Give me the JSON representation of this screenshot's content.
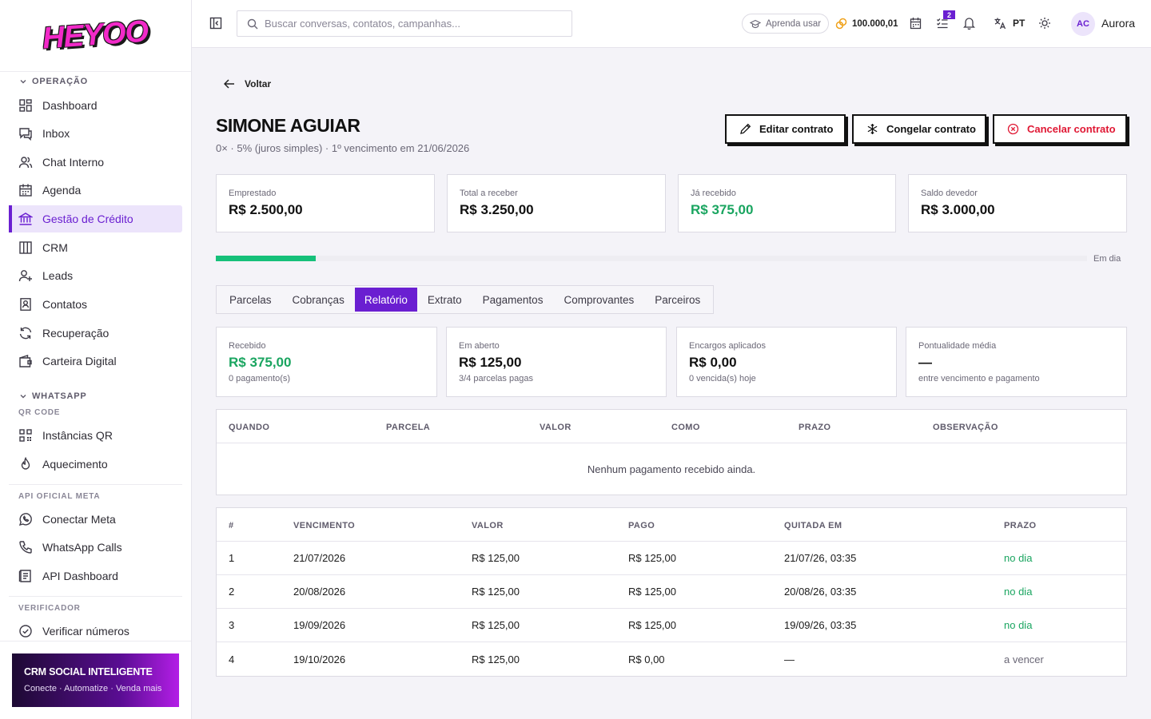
{
  "brand": {
    "logo_text": "HEYOO"
  },
  "sidebar": {
    "sections": {
      "operacao": "OPERAÇÃO",
      "whatsapp": "WHATSAPP",
      "qr_code": "QR CODE",
      "api_oficial": "API OFICIAL META",
      "verificador": "VERIFICADOR"
    },
    "items": [
      {
        "label": "Dashboard",
        "icon": "dashboard-icon"
      },
      {
        "label": "Inbox",
        "icon": "inbox-icon"
      },
      {
        "label": "Chat Interno",
        "icon": "users-icon"
      },
      {
        "label": "Agenda",
        "icon": "calendar-icon"
      },
      {
        "label": "Gestão de Crédito",
        "icon": "bank-icon",
        "active": true
      },
      {
        "label": "CRM",
        "icon": "columns-icon"
      },
      {
        "label": "Leads",
        "icon": "user-plus-icon"
      },
      {
        "label": "Contatos",
        "icon": "contact-icon"
      },
      {
        "label": "Recuperação",
        "icon": "refresh-icon"
      },
      {
        "label": "Carteira Digital",
        "icon": "wallet-icon"
      },
      {
        "label": "Instâncias QR",
        "icon": "qr-icon"
      },
      {
        "label": "Aquecimento",
        "icon": "flame-icon"
      },
      {
        "label": "Conectar Meta",
        "icon": "whatsapp-icon"
      },
      {
        "label": "WhatsApp Calls",
        "icon": "phone-icon"
      },
      {
        "label": "API Dashboard",
        "icon": "api-icon"
      },
      {
        "label": "Verificar números",
        "icon": "check-circle-icon"
      }
    ],
    "promo": {
      "title": "CRM SOCIAL INTELIGENTE",
      "subtitle": "Conecte · Automatize · Venda mais"
    }
  },
  "topbar": {
    "search_placeholder": "Buscar conversas, contatos, campanhas...",
    "learn_label": "Aprenda usar",
    "credits": "100.000,01",
    "tasks_badge": "2",
    "language": "PT",
    "avatar_initials": "AC",
    "username": "Aurora"
  },
  "page": {
    "back_label": "Voltar",
    "title": "SIMONE AGUIAR",
    "subtitle": "0× · 5% (juros simples) · 1º vencimento em 21/06/2026",
    "actions": {
      "edit": "Editar contrato",
      "freeze": "Congelar contrato",
      "cancel": "Cancelar contrato"
    },
    "summary": [
      {
        "label": "Emprestado",
        "value": "R$ 2.500,00"
      },
      {
        "label": "Total a receber",
        "value": "R$ 3.250,00"
      },
      {
        "label": "Já recebido",
        "value": "R$ 375,00"
      },
      {
        "label": "Saldo devedor",
        "value": "R$ 3.000,00"
      }
    ],
    "progress": {
      "fraction": 0.115,
      "status": "Em dia"
    },
    "tabs": [
      "Parcelas",
      "Cobranças",
      "Relatório",
      "Extrato",
      "Pagamentos",
      "Comprovantes",
      "Parceiros"
    ],
    "active_tab": "Relatório",
    "report": [
      {
        "label": "Recebido",
        "value": "R$ 375,00",
        "sub": "0 pagamento(s)"
      },
      {
        "label": "Em aberto",
        "value": "R$ 125,00",
        "sub": "3/4 parcelas pagas"
      },
      {
        "label": "Encargos aplicados",
        "value": "R$ 0,00",
        "sub": "0 vencida(s) hoje"
      },
      {
        "label": "Pontualidade média",
        "value": "—",
        "sub": "entre vencimento e pagamento"
      }
    ],
    "payments_table": {
      "headers": [
        "QUANDO",
        "PARCELA",
        "VALOR",
        "COMO",
        "PRAZO",
        "OBSERVAÇÃO"
      ],
      "empty": "Nenhum pagamento recebido ainda."
    },
    "installments_table": {
      "headers": [
        "#",
        "VENCIMENTO",
        "VALOR",
        "PAGO",
        "QUITADA EM",
        "PRAZO"
      ],
      "rows": [
        [
          "1",
          "21/07/2026",
          "R$ 125,00",
          "R$ 125,00",
          "21/07/26, 03:35",
          "no dia"
        ],
        [
          "2",
          "20/08/2026",
          "R$ 125,00",
          "R$ 125,00",
          "20/08/26, 03:35",
          "no dia"
        ],
        [
          "3",
          "19/09/2026",
          "R$ 125,00",
          "R$ 125,00",
          "19/09/26, 03:35",
          "no dia"
        ],
        [
          "4",
          "19/10/2026",
          "R$ 125,00",
          "R$ 0,00",
          "—",
          "a vencer"
        ]
      ]
    }
  },
  "colors": {
    "accent": "#6a1fd1",
    "success": "#1aa560",
    "danger": "#e01834",
    "progress": "#16c07a"
  }
}
